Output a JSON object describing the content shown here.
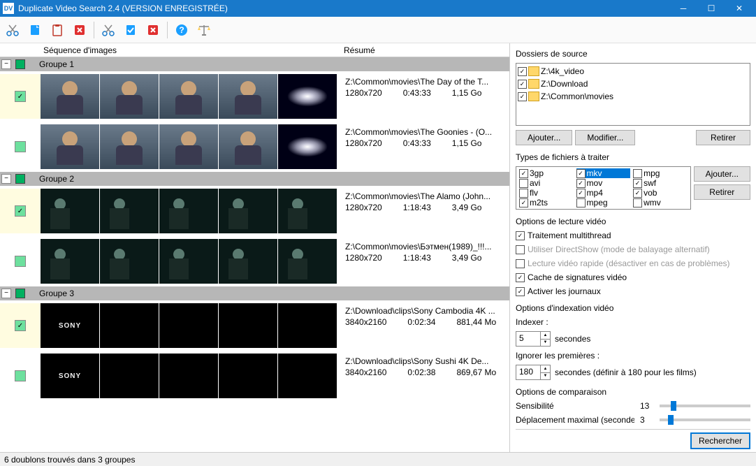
{
  "window": {
    "title": "Duplicate Video Search 2.4 (VERSION ENREGISTRÉE)"
  },
  "columns": {
    "sequence": "Séquence d'images",
    "summary": "Résumé"
  },
  "groups": [
    {
      "name": "Groupe 1",
      "videos": [
        {
          "checked": true,
          "path": "Z:\\Common\\movies\\The Day of the T...",
          "res": "1280x720",
          "dur": "0:43:33",
          "size": "1,15 Go",
          "thumb": "man"
        },
        {
          "checked": false,
          "path": "Z:\\Common\\movies\\The Goonies - (O...",
          "res": "1280x720",
          "dur": "0:43:33",
          "size": "1,15 Go",
          "thumb": "man"
        }
      ]
    },
    {
      "name": "Groupe 2",
      "videos": [
        {
          "checked": true,
          "path": "Z:\\Common\\movies\\The Alamo (John...",
          "res": "1280x720",
          "dur": "1:18:43",
          "size": "3,49 Go",
          "thumb": "dark"
        },
        {
          "checked": false,
          "path": "Z:\\Common\\movies\\Бэтмен(1989)_!!!...",
          "res": "1280x720",
          "dur": "1:18:43",
          "size": "3,49 Go",
          "thumb": "dark"
        }
      ]
    },
    {
      "name": "Groupe 3",
      "videos": [
        {
          "checked": true,
          "path": "Z:\\Download\\clips\\Sony Cambodia 4K ...",
          "res": "3840x2160",
          "dur": "0:02:34",
          "size": "881,44 Mo",
          "thumb": "sony"
        },
        {
          "checked": false,
          "path": "Z:\\Download\\clips\\Sony Sushi 4K De...",
          "res": "3840x2160",
          "dur": "0:02:38",
          "size": "869,67 Mo",
          "thumb": "sony"
        }
      ]
    }
  ],
  "right": {
    "source_folders_label": "Dossiers de source",
    "folders": [
      "Z:\\4k_video",
      "Z:\\Download",
      "Z:\\Common\\movies"
    ],
    "add_btn": "Ajouter...",
    "modify_btn": "Modifier...",
    "remove_btn": "Retirer",
    "types_label": "Types de fichiers à traiter",
    "file_types": [
      {
        "name": "3gp",
        "checked": true
      },
      {
        "name": "mkv",
        "checked": true,
        "selected": true
      },
      {
        "name": "mpg",
        "checked": false
      },
      {
        "name": "avi",
        "checked": false
      },
      {
        "name": "mov",
        "checked": true
      },
      {
        "name": "swf",
        "checked": true
      },
      {
        "name": "flv",
        "checked": false
      },
      {
        "name": "mp4",
        "checked": true
      },
      {
        "name": "vob",
        "checked": true
      },
      {
        "name": "m2ts",
        "checked": true
      },
      {
        "name": "mpeg",
        "checked": false
      },
      {
        "name": "wmv",
        "checked": false
      }
    ],
    "types_add": "Ajouter...",
    "types_remove": "Retirer",
    "read_options_label": "Options de lecture vidéo",
    "opt_multithread": "Traitement multithread",
    "opt_directshow": "Utiliser DirectShow (mode de balayage alternatif)",
    "opt_fastread": "Lecture vidéo rapide (désactiver en cas de problèmes)",
    "opt_cache": "Cache de signatures vidéo",
    "opt_logs": "Activer les journaux",
    "index_options_label": "Options d'indexation vidéo",
    "indexer_label": "Indexer :",
    "indexer_val": "5",
    "indexer_unit": "secondes",
    "skip_label": "Ignorer les premières :",
    "skip_val": "180",
    "skip_unit": "secondes (définir à 180 pour les films)",
    "compare_label": "Options de comparaison",
    "sensitivity_label": "Sensibilité",
    "sensitivity_val": "13",
    "shift_label": "Déplacement maximal (secondes)",
    "shift_val": "3",
    "search_btn": "Rechercher"
  },
  "statusbar": "6 doublons trouvés dans 3 groupes"
}
